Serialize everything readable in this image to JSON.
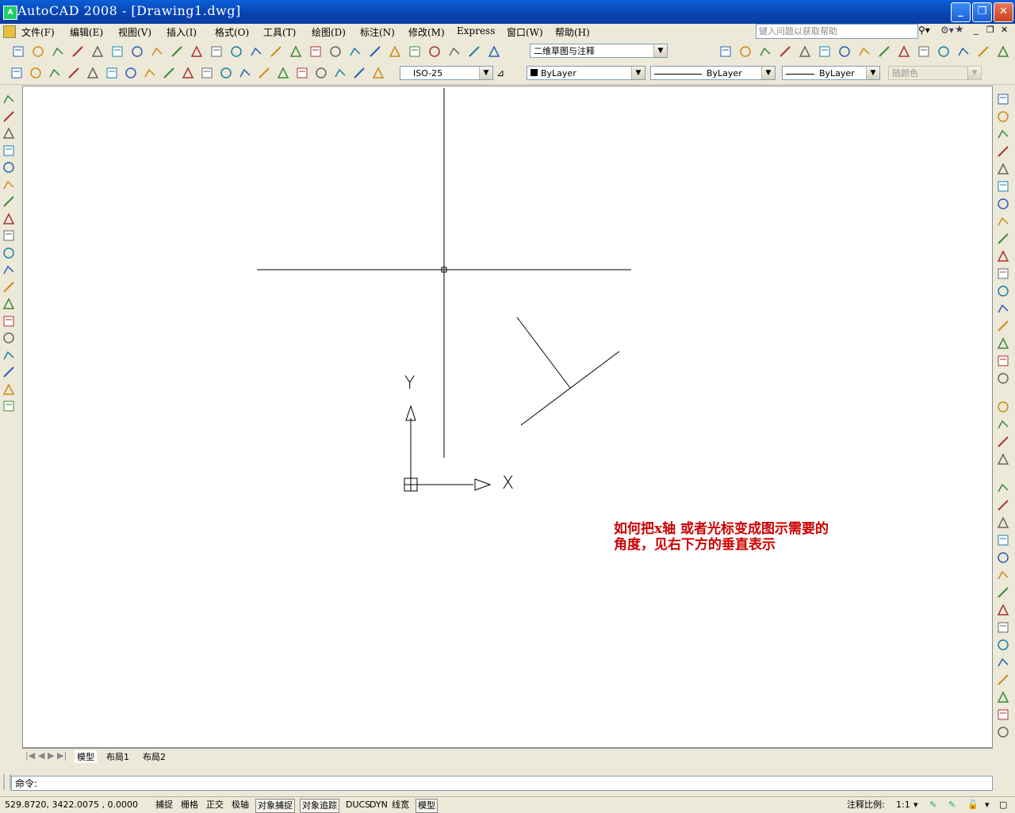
{
  "window": {
    "title": "AutoCAD 2008 - [Drawing1.dwg]",
    "app_icon": "A",
    "minimize": "_",
    "restore": "❐",
    "close": "✕"
  },
  "menu": [
    "文件(F)",
    "编辑(E)",
    "视图(V)",
    "插入(I)",
    "格式(O)",
    "工具(T)",
    "绘图(D)",
    "标注(N)",
    "修改(M)",
    "Express",
    "窗口(W)",
    "帮助(H)"
  ],
  "help": {
    "placeholder": "键入问题以获取帮助"
  },
  "workspace": {
    "value": "二维草图与注释"
  },
  "dim_style": {
    "value": "ISO-25"
  },
  "layer": {
    "color_value": "ByLayer",
    "linetype_value": "ByLayer",
    "lineweight_value": "ByLayer",
    "plot_color": "随颜色"
  },
  "ucs": {
    "x_label": "X",
    "y_label": "Y"
  },
  "annotation": {
    "line1": "如何把x轴 或者光标变成图示需要的",
    "line2": "角度，见右下方的垂直表示",
    "color": "#cc0000"
  },
  "tabs": [
    "模型",
    "布局1",
    "布局2"
  ],
  "command": {
    "prompt": "命令:"
  },
  "status": {
    "coords": "529.8720,   3422.0075 ,  0.0000",
    "toggles": [
      "捕捉",
      "栅格",
      "正交",
      "极轴",
      "对象捕捉",
      "对象追踪",
      "DUCS",
      "DYN",
      "线宽",
      "模型"
    ],
    "on": [
      false,
      false,
      false,
      false,
      true,
      true,
      false,
      false,
      false,
      true
    ],
    "scale_label": "注释比例:",
    "scale_value": "1:1"
  },
  "icons": {
    "std_toolbar": [
      "new-icon",
      "open-icon",
      "save-icon",
      "print-icon",
      "plot-preview-icon",
      "publish-icon",
      "3d-dwf-icon",
      "cut-icon",
      "copy-icon",
      "paste-icon",
      "match-properties-icon",
      "block-editor-icon",
      "undo-icon",
      "redo-icon",
      "pan-icon",
      "zoom-realtime-icon",
      "zoom-window-icon",
      "zoom-previous-icon",
      "properties-icon",
      "design-center-icon",
      "tool-palettes-icon",
      "sheet-set-icon",
      "markup-icon",
      "quickcalc-icon",
      "help-icon"
    ],
    "dim_toolbar": [
      "linear-dim-icon",
      "aligned-dim-icon",
      "arc-length-icon",
      "ordinate-dim-icon",
      "radius-dim-icon",
      "jogged-dim-icon",
      "diameter-dim-icon",
      "angular-dim-icon",
      "quick-dim-icon",
      "baseline-dim-icon",
      "continue-dim-icon",
      "dim-space-icon",
      "dim-break-icon",
      "tolerance-icon",
      "center-mark-icon",
      "inspection-icon",
      "jogged-linear-icon",
      "dim-edit-icon",
      "dim-text-edit-icon",
      "dim-update-icon"
    ],
    "draw_toolbar": [
      "line-icon",
      "construction-line-icon",
      "polyline-icon",
      "polygon-icon",
      "rectangle-icon",
      "arc-icon",
      "circle-icon",
      "revision-cloud-icon",
      "spline-icon",
      "ellipse-icon",
      "ellipse-arc-icon",
      "insert-block-icon",
      "make-block-icon",
      "point-icon",
      "hatch-icon",
      "gradient-icon",
      "region-icon",
      "table-icon",
      "multiline-text-icon"
    ],
    "modify_toolbar": [
      "erase-icon",
      "copy-object-icon",
      "mirror-icon",
      "offset-icon",
      "array-icon",
      "move-icon",
      "rotate-icon",
      "scale-icon",
      "stretch-icon",
      "trim-icon",
      "extend-icon",
      "break-point-icon",
      "break-icon",
      "join-icon",
      "chamfer-icon",
      "fillet-icon",
      "explode-icon"
    ],
    "layers_toolbar": [
      "layer-manager-icon",
      "layer-state-icon",
      "layer-previous-icon",
      "make-current-icon"
    ],
    "modeling_toolbar": [
      "polysolid-icon",
      "box-icon",
      "wedge-icon",
      "cone-icon",
      "sphere-icon",
      "cylinder-icon",
      "torus-icon",
      "pyramid-icon",
      "helix-icon",
      "planar-surface-icon",
      "extrude-icon",
      "presspull-icon",
      "sweep-icon",
      "revolve-icon",
      "loft-icon"
    ]
  }
}
